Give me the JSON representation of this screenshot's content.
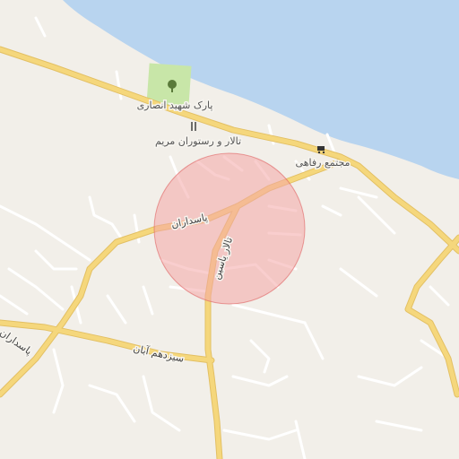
{
  "map": {
    "colors": {
      "land": "#f2efe9",
      "water": "#b8d4ef",
      "major_road": "#f5d77c",
      "major_road_casing": "#e3c064",
      "minor_road": "#ffffff",
      "minor_road_casing": "#cfcac2",
      "park": "#c8e6a8",
      "highlight_fill": "#f4a6a6",
      "highlight_stroke": "#e06060"
    },
    "labels": {
      "park": "پارک شهید انصاری",
      "restaurant": "تالار و رستوران مریم",
      "welfare_complex": "مجتمع رفاهی",
      "pasdaran_main": "پاسداران",
      "pasdaran_west": "پاسداران",
      "sizdah_aban": "سیزدهم آبان",
      "talar_yasin": "تالار یاسین"
    },
    "icons": {
      "park": "tree-icon",
      "restaurant": "fork-knife-icon",
      "shop": "shopping-cart-icon"
    }
  }
}
